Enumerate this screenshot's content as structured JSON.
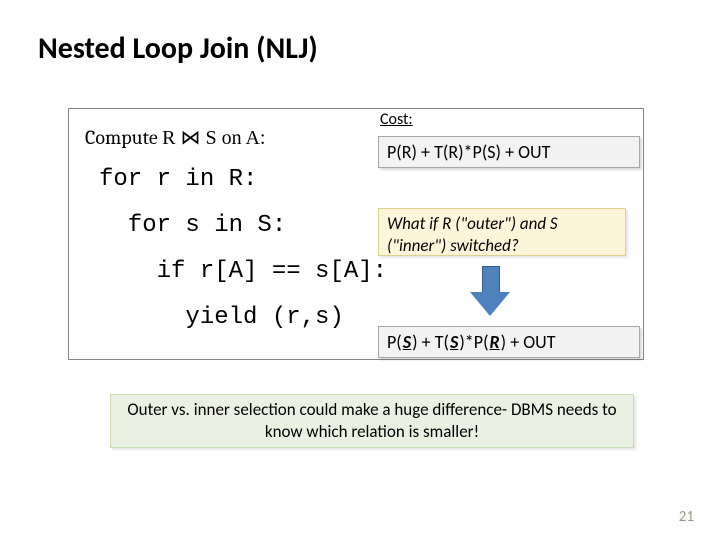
{
  "title": "Nested Loop Join (NLJ)",
  "code": {
    "compute_prefix": "Compute ",
    "compute_expr": "R ⋈ S on A:",
    "pseudocode": "for r in R:\n  for s in S:\n    if r[A] == s[A]:\n      yield (r,s)"
  },
  "cost_label": "Cost:",
  "formula1": "P(R) + T(R)*P(S) + OUT",
  "question": "What if R (\"outer\") and S (\"inner\") switched?",
  "formula2": {
    "pre": "P(",
    "s1": "S",
    "mid1": ") + T(",
    "s2": "S",
    "mid2": ")*P(",
    "r1": "R",
    "post": ") + OUT"
  },
  "summary": "Outer vs. inner selection could make a huge difference- DBMS needs to know which relation is smaller!",
  "page_number": "21"
}
